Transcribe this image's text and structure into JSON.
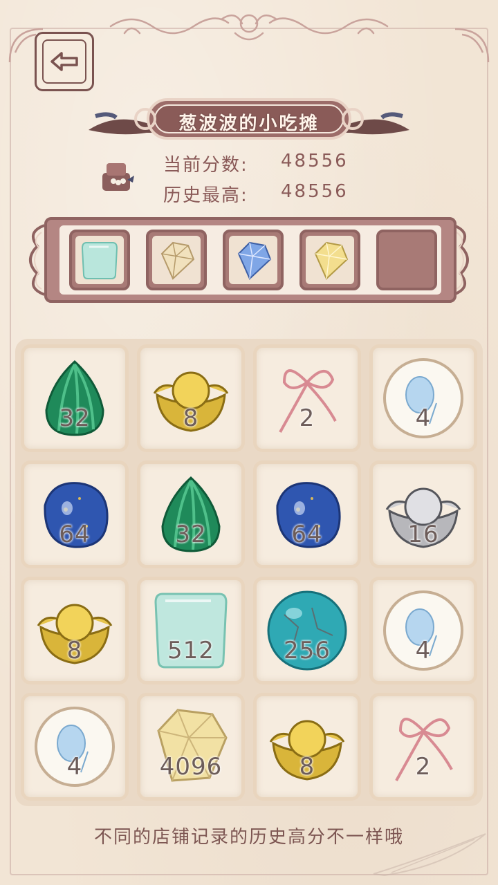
{
  "header": {
    "back_icon": "arrow-left-icon",
    "shop_title": "葱波波的小吃摊"
  },
  "score": {
    "current_label": "当前分数:",
    "current_value": "48556",
    "best_label": "历史最高:",
    "best_value": "48556"
  },
  "collection_slots": [
    {
      "item": "jade-tile",
      "filled": true
    },
    {
      "item": "champagne-crystal",
      "filled": true
    },
    {
      "item": "blue-crystal",
      "filled": true
    },
    {
      "item": "yellow-crystal",
      "filled": true
    },
    {
      "item": "",
      "filled": false
    }
  ],
  "board": {
    "rows": [
      [
        {
          "item": "malachite-drop",
          "value": "32"
        },
        {
          "item": "gold-ingot",
          "value": "8"
        },
        {
          "item": "pink-ribbon",
          "value": "2"
        },
        {
          "item": "pearl-plate",
          "value": "4"
        }
      ],
      [
        {
          "item": "lapis-stone",
          "value": "64"
        },
        {
          "item": "malachite-drop",
          "value": "32"
        },
        {
          "item": "lapis-stone",
          "value": "64"
        },
        {
          "item": "silver-ingot",
          "value": "16"
        }
      ],
      [
        {
          "item": "gold-ingot",
          "value": "8"
        },
        {
          "item": "jade-tile",
          "value": "512"
        },
        {
          "item": "turquoise-orb",
          "value": "256"
        },
        {
          "item": "pearl-plate",
          "value": "4"
        }
      ],
      [
        {
          "item": "pearl-plate",
          "value": "4"
        },
        {
          "item": "yellow-crystal",
          "value": "4096"
        },
        {
          "item": "gold-ingot",
          "value": "8"
        },
        {
          "item": "pink-ribbon",
          "value": "2"
        }
      ]
    ]
  },
  "footer": {
    "tip": "不同的店铺记录的历史高分不一样哦"
  },
  "colors": {
    "background": "#f2e5d5",
    "frame": "#8f6361",
    "text": "#7a5350"
  }
}
